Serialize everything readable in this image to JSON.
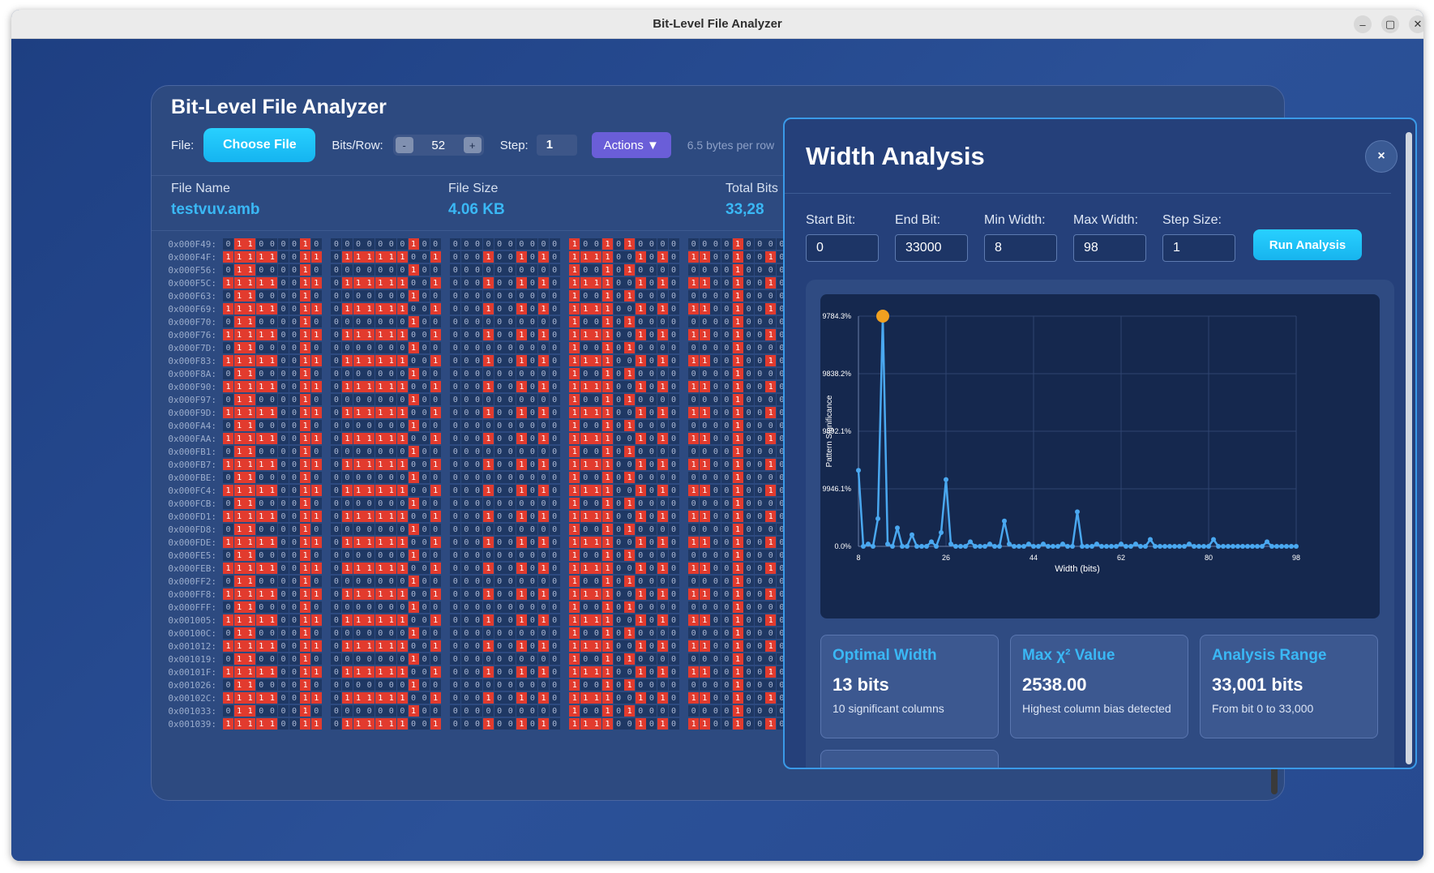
{
  "window": {
    "title": "Bit-Level File Analyzer"
  },
  "app": {
    "title": "Bit-Level File Analyzer",
    "file_label": "File:",
    "choose_file": "Choose File",
    "bits_row_label": "Bits/Row:",
    "bits_row_value": "52",
    "minus": "-",
    "plus": "+",
    "step_label": "Step:",
    "step_value": "1",
    "actions": "Actions ▼",
    "bytes_per_row": "6.5 bytes per row"
  },
  "info": {
    "file_name_label": "File Name",
    "file_name": "testvuv.amb",
    "file_size_label": "File Size",
    "file_size": "4.06 KB",
    "total_bits_label": "Total Bits",
    "total_bits": "33,28"
  },
  "rows": {
    "addresses": [
      "0x000F49:",
      "0x000F4F:",
      "0x000F56:",
      "0x000F5C:",
      "0x000F63:",
      "0x000F69:",
      "0x000F70:",
      "0x000F76:",
      "0x000F7D:",
      "0x000F83:",
      "0x000F8A:",
      "0x000F90:",
      "0x000F97:",
      "0x000F9D:",
      "0x000FA4:",
      "0x000FAA:",
      "0x000FB1:",
      "0x000FB7:",
      "0x000FBE:",
      "0x000FC4:",
      "0x000FCB:",
      "0x000FD1:",
      "0x000FD8:",
      "0x000FDE:",
      "0x000FE5:",
      "0x000FEB:",
      "0x000FF2:",
      "0x000FF8:",
      "0x000FFF:",
      "0x001005:",
      "0x00100C:",
      "0x001012:",
      "0x001019:",
      "0x00101F:",
      "0x001026:",
      "0x00102C:",
      "0x001033:",
      "0x001039:"
    ],
    "pattern_a": "01100001000000001000000000000100101000000001000000001",
    "pattern_b": "11111001101111110010001001010111100101011001001001100"
  },
  "modal": {
    "title": "Width Analysis",
    "close": "×",
    "params": [
      {
        "label": "Start Bit:",
        "value": "0"
      },
      {
        "label": "End Bit:",
        "value": "33000"
      },
      {
        "label": "Min Width:",
        "value": "8"
      },
      {
        "label": "Max Width:",
        "value": "98"
      },
      {
        "label": "Step Size:",
        "value": "1"
      }
    ],
    "run": "Run Analysis",
    "stats": [
      {
        "title": "Optimal Width",
        "value": "13 bits",
        "desc": "10 significant columns"
      },
      {
        "title": "Max χ² Value",
        "value": "2538.00",
        "desc": "Highest column bias detected"
      },
      {
        "title": "Analysis Range",
        "value": "33,001 bits",
        "desc": "From bit 0 to 33,000"
      }
    ]
  },
  "chart_data": {
    "type": "line",
    "xlabel": "Width (bits)",
    "ylabel": "Pattern Significance",
    "x_ticks": [
      "8",
      "26",
      "44",
      "62",
      "80",
      "98"
    ],
    "y_ticks": [
      "9784.3%",
      "9838.2%",
      "9892.1%",
      "9946.1%",
      "0.0%"
    ],
    "xlim": [
      8,
      98
    ],
    "highlight": {
      "x": 13,
      "label": "optimal"
    },
    "series": [
      {
        "x": [
          8,
          9,
          10,
          11,
          12,
          13,
          14,
          15,
          16,
          17,
          18,
          19,
          20,
          21,
          22,
          23,
          24,
          25,
          26,
          27,
          28,
          29,
          30,
          31,
          32,
          33,
          34,
          35,
          36,
          37,
          38,
          39,
          40,
          41,
          42,
          43,
          44,
          45,
          46,
          47,
          48,
          49,
          50,
          51,
          52,
          53,
          54,
          55,
          56,
          57,
          58,
          59,
          60,
          61,
          62,
          63,
          64,
          65,
          66,
          67,
          68,
          69,
          70,
          71,
          72,
          73,
          74,
          75,
          76,
          77,
          78,
          79,
          80,
          81,
          82,
          83,
          84,
          85,
          86,
          87,
          88,
          89,
          90,
          91,
          92,
          93,
          94,
          95,
          96,
          97,
          98
        ],
        "y": [
          33,
          0,
          1,
          0,
          12,
          100,
          1,
          0,
          8,
          0,
          0,
          5,
          0,
          0,
          0,
          2,
          0,
          6,
          29,
          1,
          0,
          0,
          0,
          2,
          0,
          0,
          0,
          1,
          0,
          0,
          11,
          1,
          0,
          0,
          0,
          1,
          0,
          0,
          1,
          0,
          0,
          0,
          1,
          0,
          0,
          15,
          0,
          0,
          0,
          1,
          0,
          0,
          0,
          0,
          1,
          0,
          0,
          1,
          0,
          0,
          3,
          0,
          0,
          0,
          0,
          0,
          0,
          0,
          1,
          0,
          0,
          0,
          0,
          3,
          0,
          0,
          0,
          0,
          0,
          0,
          0,
          0,
          0,
          0,
          2,
          0,
          0,
          0,
          0,
          0,
          0
        ]
      }
    ]
  }
}
